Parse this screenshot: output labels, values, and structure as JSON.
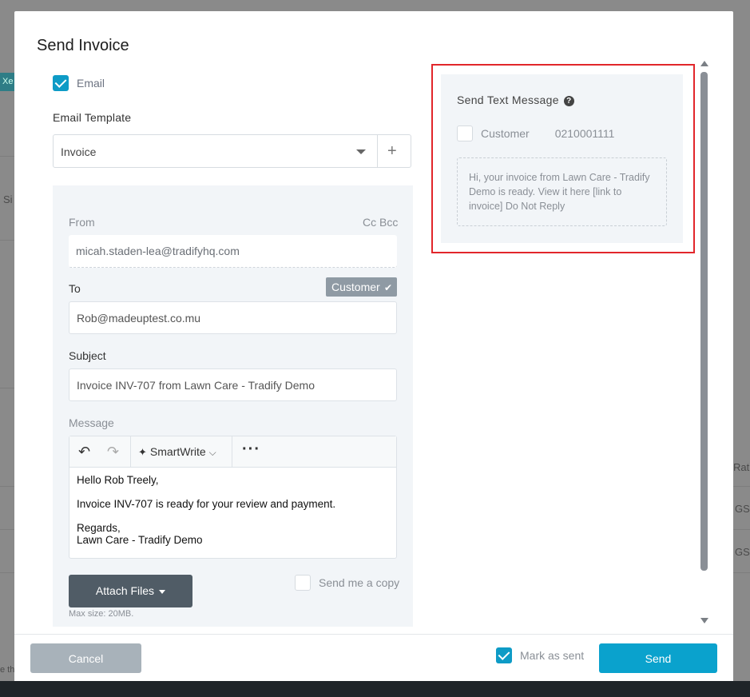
{
  "background": {
    "chip_text": "Xe",
    "left_text": "Si",
    "right_header": "Rat",
    "right_rows": [
      "GS",
      "GS"
    ],
    "bottom_left_text": "e th"
  },
  "dialog": {
    "title": "Send Invoice",
    "email_label": "Email",
    "email_checked": true,
    "template_label": "Email Template",
    "template_value": "Invoice",
    "add_template_icon": "plus-icon"
  },
  "form": {
    "from_label": "From",
    "cc_bcc_label": "Cc Bcc",
    "from_value": "micah.staden-lea@tradifyhq.com",
    "to_label": "To",
    "customer_badge": "Customer",
    "to_value": "Rob@madeuptest.co.mu",
    "subject_label": "Subject",
    "subject_value": "Invoice INV-707 from Lawn Care - Tradify Demo",
    "message_label": "Message",
    "smartwrite_label": "SmartWrite",
    "message_lines": {
      "greeting": "Hello Rob Treely,",
      "body": "Invoice INV-707 is ready for your review and payment.",
      "closing": "Regards,",
      "signature": "Lawn Care - Tradify Demo"
    },
    "attach_label": "Attach Files",
    "max_size": "Max size: 20MB.",
    "send_copy_label": "Send me a copy",
    "send_copy_checked": false
  },
  "sms": {
    "title": "Send Text Message",
    "customer_label": "Customer",
    "customer_phone": "0210001111",
    "customer_checked": false,
    "message_text": "Hi, your invoice from Lawn Care - Tradify Demo is ready. View it here [link to invoice] Do Not Reply"
  },
  "footer": {
    "cancel_label": "Cancel",
    "mark_as_sent_label": "Mark as sent",
    "mark_as_sent_checked": true,
    "send_label": "Send"
  },
  "colors": {
    "accent": "#0aa2cd",
    "highlight_border": "#e2262b",
    "panel_bg": "#f2f5f8",
    "dark_button": "#505c66"
  }
}
